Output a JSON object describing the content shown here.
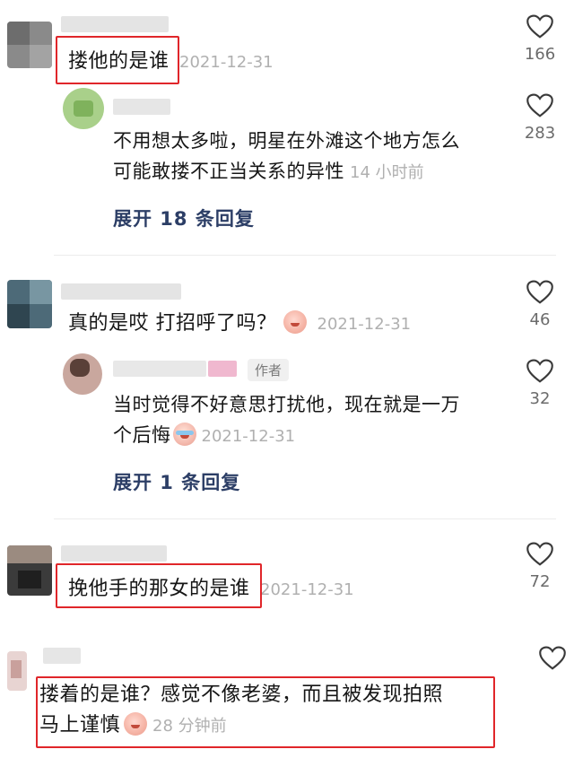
{
  "comments": [
    {
      "text": "搂他的是谁",
      "time": "2021-12-31",
      "likes": "166",
      "reply": {
        "text_line1": "不用想太多啦，明星在外滩这个地方怎么",
        "text_line2": "可能敢搂不正当关系的异性",
        "time": "14 小时前",
        "likes": "283"
      },
      "expand_label": "展开 18 条回复"
    },
    {
      "text": "真的是哎 打招呼了吗？",
      "time": "2021-12-31",
      "likes": "46",
      "emoji": "grin-emoji",
      "reply": {
        "author_tag": "作者",
        "text_line1": "当时觉得不好意思打扰他，现在就是一万",
        "text_line2": "个后悔",
        "time": "2021-12-31",
        "likes": "32",
        "emoji": "crying-emoji"
      },
      "expand_label": "展开 1 条回复"
    },
    {
      "text": "挽他手的那女的是谁",
      "time": "2021-12-31",
      "likes": "72"
    },
    {
      "text_line1": "搂着的是谁？感觉不像老婆，而且被发现拍照",
      "text_line2": "马上谨慎",
      "time": "28 分钟前",
      "likes": "",
      "emoji": "smile-emoji"
    }
  ],
  "colors": {
    "highlight": "#e0262a",
    "expand_link": "#2c3e66",
    "timestamp": "#b0b0b0"
  }
}
